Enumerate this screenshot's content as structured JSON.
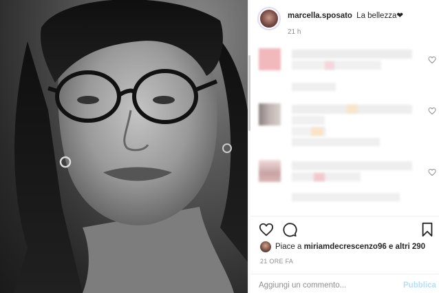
{
  "post": {
    "username": "marcella.sposato",
    "caption": "La bellezza❤",
    "time": "21 h"
  },
  "actions": {
    "like_icon": "heart-outline-icon",
    "comment_icon": "speech-bubble-icon",
    "save_icon": "bookmark-icon"
  },
  "likes": {
    "prefix": "Piace a",
    "user": "miriamdecrescenzo96",
    "suffix": "e altri 290"
  },
  "date": "21 ORE FA",
  "comment_box": {
    "placeholder": "Aggiungi un commento...",
    "publish_label": "Pubblica"
  },
  "colors": {
    "link_disabled": "#b2dffc",
    "muted": "#8e8e8e",
    "text": "#262626"
  }
}
